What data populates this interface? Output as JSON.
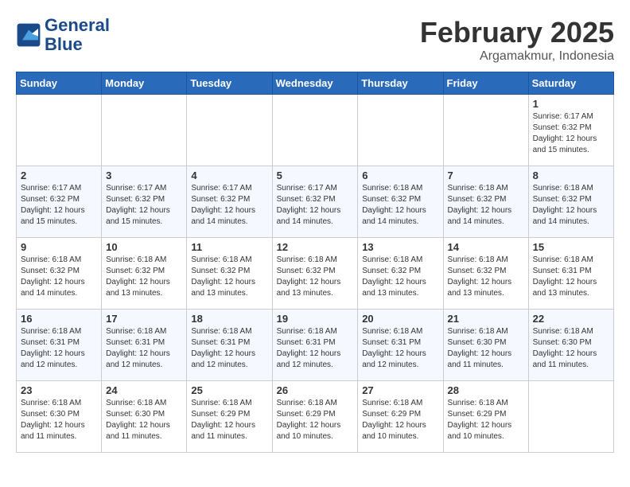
{
  "logo": {
    "line1": "General",
    "line2": "Blue"
  },
  "title": {
    "month_year": "February 2025",
    "location": "Argamakmur, Indonesia"
  },
  "days_of_week": [
    "Sunday",
    "Monday",
    "Tuesday",
    "Wednesday",
    "Thursday",
    "Friday",
    "Saturday"
  ],
  "weeks": [
    [
      {
        "day": "",
        "info": ""
      },
      {
        "day": "",
        "info": ""
      },
      {
        "day": "",
        "info": ""
      },
      {
        "day": "",
        "info": ""
      },
      {
        "day": "",
        "info": ""
      },
      {
        "day": "",
        "info": ""
      },
      {
        "day": "1",
        "info": "Sunrise: 6:17 AM\nSunset: 6:32 PM\nDaylight: 12 hours and 15 minutes."
      }
    ],
    [
      {
        "day": "2",
        "info": "Sunrise: 6:17 AM\nSunset: 6:32 PM\nDaylight: 12 hours and 15 minutes."
      },
      {
        "day": "3",
        "info": "Sunrise: 6:17 AM\nSunset: 6:32 PM\nDaylight: 12 hours and 15 minutes."
      },
      {
        "day": "4",
        "info": "Sunrise: 6:17 AM\nSunset: 6:32 PM\nDaylight: 12 hours and 14 minutes."
      },
      {
        "day": "5",
        "info": "Sunrise: 6:17 AM\nSunset: 6:32 PM\nDaylight: 12 hours and 14 minutes."
      },
      {
        "day": "6",
        "info": "Sunrise: 6:18 AM\nSunset: 6:32 PM\nDaylight: 12 hours and 14 minutes."
      },
      {
        "day": "7",
        "info": "Sunrise: 6:18 AM\nSunset: 6:32 PM\nDaylight: 12 hours and 14 minutes."
      },
      {
        "day": "8",
        "info": "Sunrise: 6:18 AM\nSunset: 6:32 PM\nDaylight: 12 hours and 14 minutes."
      }
    ],
    [
      {
        "day": "9",
        "info": "Sunrise: 6:18 AM\nSunset: 6:32 PM\nDaylight: 12 hours and 14 minutes."
      },
      {
        "day": "10",
        "info": "Sunrise: 6:18 AM\nSunset: 6:32 PM\nDaylight: 12 hours and 13 minutes."
      },
      {
        "day": "11",
        "info": "Sunrise: 6:18 AM\nSunset: 6:32 PM\nDaylight: 12 hours and 13 minutes."
      },
      {
        "day": "12",
        "info": "Sunrise: 6:18 AM\nSunset: 6:32 PM\nDaylight: 12 hours and 13 minutes."
      },
      {
        "day": "13",
        "info": "Sunrise: 6:18 AM\nSunset: 6:32 PM\nDaylight: 12 hours and 13 minutes."
      },
      {
        "day": "14",
        "info": "Sunrise: 6:18 AM\nSunset: 6:32 PM\nDaylight: 12 hours and 13 minutes."
      },
      {
        "day": "15",
        "info": "Sunrise: 6:18 AM\nSunset: 6:31 PM\nDaylight: 12 hours and 13 minutes."
      }
    ],
    [
      {
        "day": "16",
        "info": "Sunrise: 6:18 AM\nSunset: 6:31 PM\nDaylight: 12 hours and 12 minutes."
      },
      {
        "day": "17",
        "info": "Sunrise: 6:18 AM\nSunset: 6:31 PM\nDaylight: 12 hours and 12 minutes."
      },
      {
        "day": "18",
        "info": "Sunrise: 6:18 AM\nSunset: 6:31 PM\nDaylight: 12 hours and 12 minutes."
      },
      {
        "day": "19",
        "info": "Sunrise: 6:18 AM\nSunset: 6:31 PM\nDaylight: 12 hours and 12 minutes."
      },
      {
        "day": "20",
        "info": "Sunrise: 6:18 AM\nSunset: 6:31 PM\nDaylight: 12 hours and 12 minutes."
      },
      {
        "day": "21",
        "info": "Sunrise: 6:18 AM\nSunset: 6:30 PM\nDaylight: 12 hours and 11 minutes."
      },
      {
        "day": "22",
        "info": "Sunrise: 6:18 AM\nSunset: 6:30 PM\nDaylight: 12 hours and 11 minutes."
      }
    ],
    [
      {
        "day": "23",
        "info": "Sunrise: 6:18 AM\nSunset: 6:30 PM\nDaylight: 12 hours and 11 minutes."
      },
      {
        "day": "24",
        "info": "Sunrise: 6:18 AM\nSunset: 6:30 PM\nDaylight: 12 hours and 11 minutes."
      },
      {
        "day": "25",
        "info": "Sunrise: 6:18 AM\nSunset: 6:29 PM\nDaylight: 12 hours and 11 minutes."
      },
      {
        "day": "26",
        "info": "Sunrise: 6:18 AM\nSunset: 6:29 PM\nDaylight: 12 hours and 10 minutes."
      },
      {
        "day": "27",
        "info": "Sunrise: 6:18 AM\nSunset: 6:29 PM\nDaylight: 12 hours and 10 minutes."
      },
      {
        "day": "28",
        "info": "Sunrise: 6:18 AM\nSunset: 6:29 PM\nDaylight: 12 hours and 10 minutes."
      },
      {
        "day": "",
        "info": ""
      }
    ]
  ]
}
